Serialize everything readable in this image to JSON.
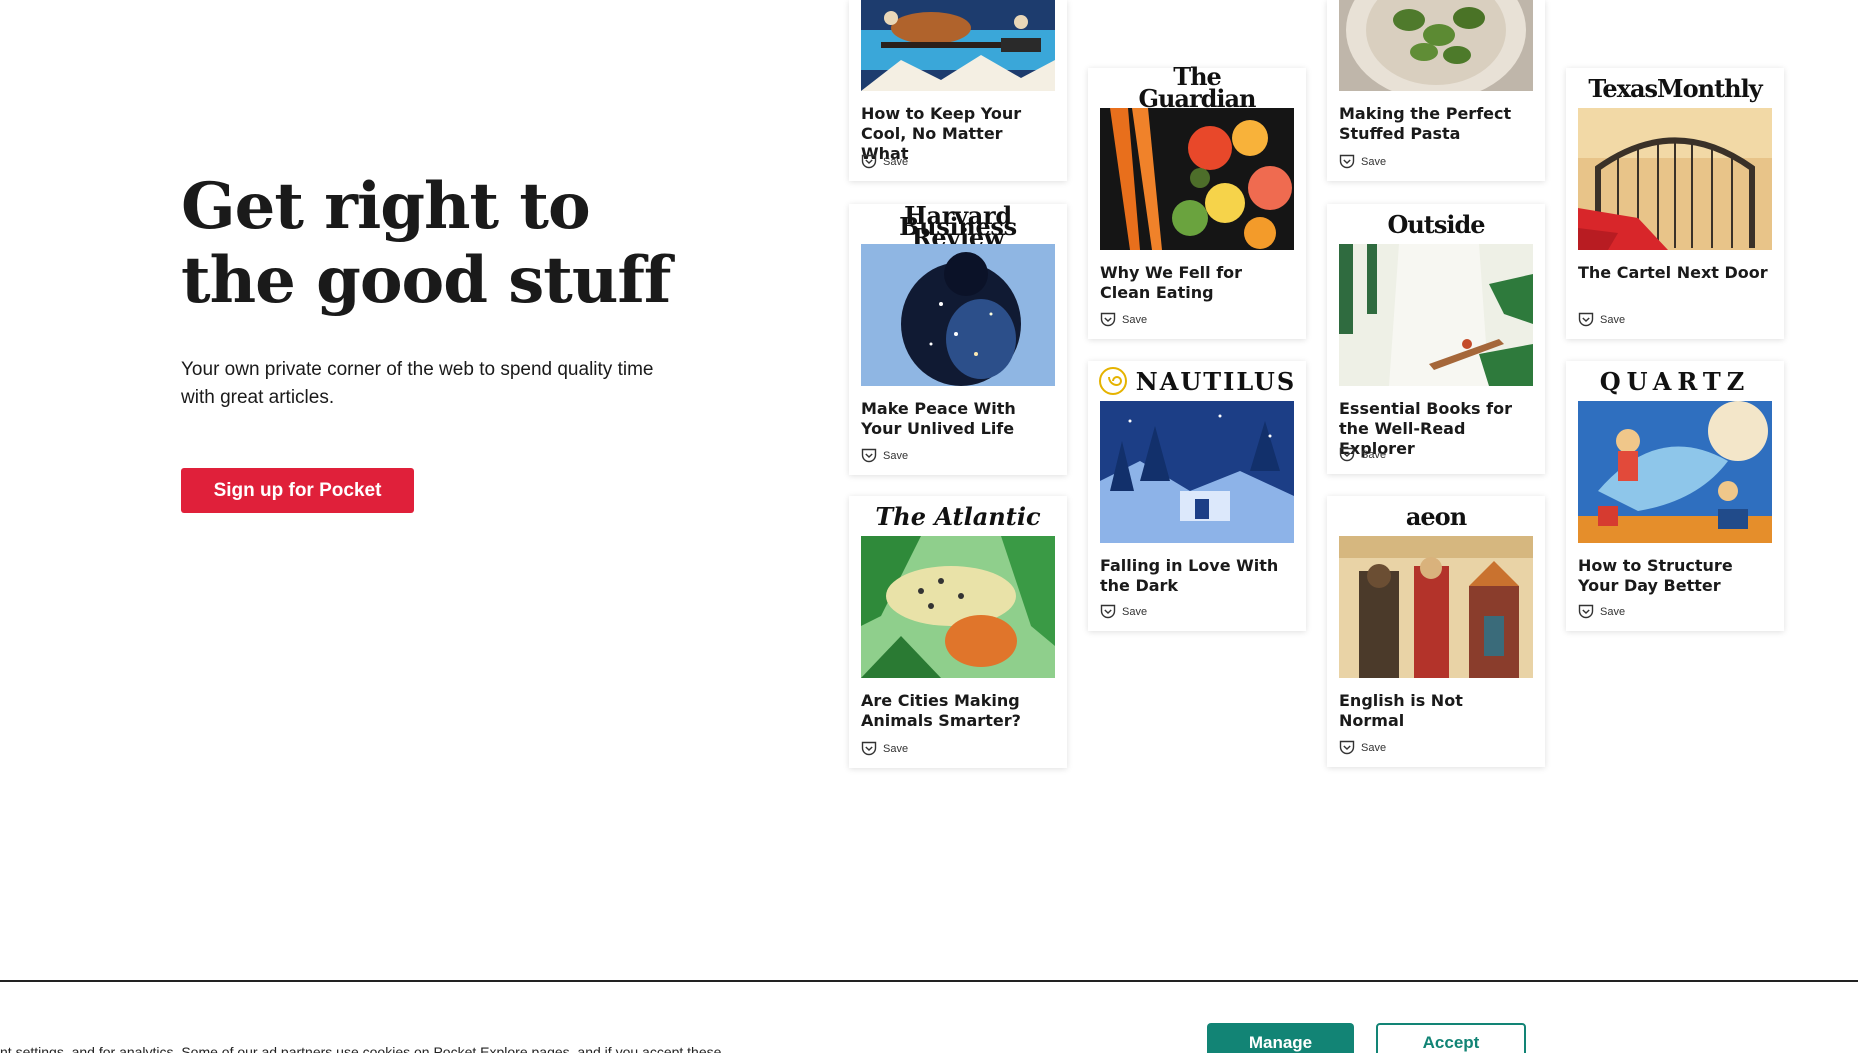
{
  "hero": {
    "title_line1": "Get right to",
    "title_line2": "the good stuff",
    "subtitle": "Your own private corner of the web to spend quality time with great articles.",
    "cta_label": "Sign up for Pocket",
    "cta_color": "#e0203a"
  },
  "save_label": "Save",
  "cards": {
    "keep_cool": {
      "title": "How to Keep Your Cool, No Matter What"
    },
    "hbr": {
      "logo": "Harvard Business Review",
      "title": "Make Peace With Your Unlived Life"
    },
    "atlantic": {
      "logo": "The Atlantic",
      "title": "Are Cities Making Animals Smarter?"
    },
    "guardian": {
      "logo": "The Guardian",
      "title": "Why We Fell for Clean Eating"
    },
    "nautilus": {
      "logo": "NAUTILUS",
      "title": "Falling in Love With the Dark"
    },
    "pasta": {
      "title": "Making the Perfect Stuffed Pasta"
    },
    "outside": {
      "logo": "Outside",
      "title": "Essential Books for the Well-Read Explorer"
    },
    "aeon": {
      "logo": "aeon",
      "title": "English is Not Normal"
    },
    "texas": {
      "logo": "TexasMonthly",
      "title": "The Cartel Next Door"
    },
    "quartz": {
      "logo": "QUARTZ",
      "title": "How to Structure Your Day Better"
    }
  },
  "cookie": {
    "text": "nt settings, and for analytics. Some of our ad partners use cookies on Pocket Explore pages, and if you accept these",
    "manage_label": "Manage",
    "accept_label": "Accept",
    "accent_color": "#128475"
  }
}
